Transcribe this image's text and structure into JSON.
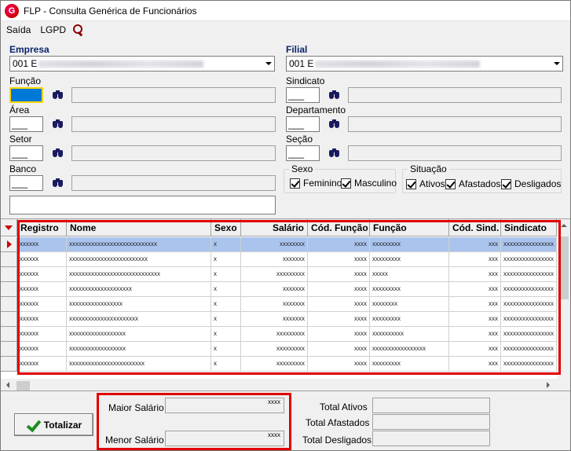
{
  "window": {
    "title": "FLP - Consulta Genérica de Funcionários"
  },
  "menu": {
    "items": [
      "Saída",
      "LGPD"
    ]
  },
  "filters": {
    "empresa_label": "Empresa",
    "empresa_value": "001 E",
    "filial_label": "Filial",
    "filial_value": "001 E",
    "funcao_label": "Função",
    "area_label": "Área",
    "setor_label": "Setor",
    "banco_label": "Banco",
    "sindicato_label": "Sindicato",
    "departamento_label": "Departamento",
    "secao_label": "Seção",
    "funcao_code": "",
    "area_code": "___",
    "setor_code": "___",
    "banco_code": "___",
    "sindicato_code": "___",
    "departamento_code": "___",
    "secao_code": "___"
  },
  "sexo": {
    "title": "Sexo",
    "feminino": "Feminino",
    "masculino": "Masculino"
  },
  "situacao": {
    "title": "Situação",
    "ativos": "Ativos",
    "afastados": "Afastados",
    "desligados": "Desligados"
  },
  "grid": {
    "columns": [
      "Registro",
      "Nome",
      "Sexo",
      "Salário",
      "Cód. Função",
      "Função",
      "Cód. Sind.",
      "Sindicato"
    ],
    "rows": [
      [
        "xxxxxx",
        "xxxxxxxxxxxxxxxxxxxxxxxxxxxx",
        "x",
        "xxxxxxxx",
        "xxxx",
        "xxxxxxxxx",
        "xxx",
        "xxxxxxxxxxxxxxxx"
      ],
      [
        "xxxxxx",
        "xxxxxxxxxxxxxxxxxxxxxxxxx",
        "x",
        "xxxxxxx",
        "xxxx",
        "xxxxxxxxx",
        "xxx",
        "xxxxxxxxxxxxxxxx"
      ],
      [
        "xxxxxx",
        "xxxxxxxxxxxxxxxxxxxxxxxxxxxxx",
        "x",
        "xxxxxxxxx",
        "xxxx",
        "xxxxx",
        "xxx",
        "xxxxxxxxxxxxxxxx"
      ],
      [
        "xxxxxx",
        "xxxxxxxxxxxxxxxxxxxx",
        "x",
        "xxxxxxx",
        "xxxx",
        "xxxxxxxxx",
        "xxx",
        "xxxxxxxxxxxxxxxx"
      ],
      [
        "xxxxxx",
        "xxxxxxxxxxxxxxxxx",
        "x",
        "xxxxxxx",
        "xxxx",
        "xxxxxxxx",
        "xxx",
        "xxxxxxxxxxxxxxxx"
      ],
      [
        "xxxxxx",
        "xxxxxxxxxxxxxxxxxxxxxx",
        "x",
        "xxxxxxx",
        "xxxx",
        "xxxxxxxxx",
        "xxx",
        "xxxxxxxxxxxxxxxx"
      ],
      [
        "xxxxxx",
        "xxxxxxxxxxxxxxxxxx",
        "x",
        "xxxxxxxxx",
        "xxxx",
        "xxxxxxxxxx",
        "xxx",
        "xxxxxxxxxxxxxxxx"
      ],
      [
        "xxxxxx",
        "xxxxxxxxxxxxxxxxxx",
        "x",
        "xxxxxxxxx",
        "xxxx",
        "xxxxxxxxxxxxxxxxx",
        "xxx",
        "xxxxxxxxxxxxxxxx"
      ],
      [
        "xxxxxx",
        "xxxxxxxxxxxxxxxxxxxxxxxx",
        "x",
        "xxxxxxxxx",
        "xxxx",
        "xxxxxxxxx",
        "xxx",
        "xxxxxxxxxxxxxxxx"
      ]
    ]
  },
  "summary": {
    "totalizar_label": "Totalizar",
    "maior_salario_label": "Maior Salário",
    "menor_salario_label": "Menor Salário",
    "maior_salario_value": "xxxx",
    "menor_salario_value": "xxxx",
    "total_ativos_label": "Total Ativos",
    "total_afastados_label": "Total Afastados",
    "total_desligados_label": "Total Desligados"
  },
  "colors": {
    "highlight_border": "#e00000",
    "selected_row": "#aac4ee",
    "active_field": "#0078d7"
  }
}
